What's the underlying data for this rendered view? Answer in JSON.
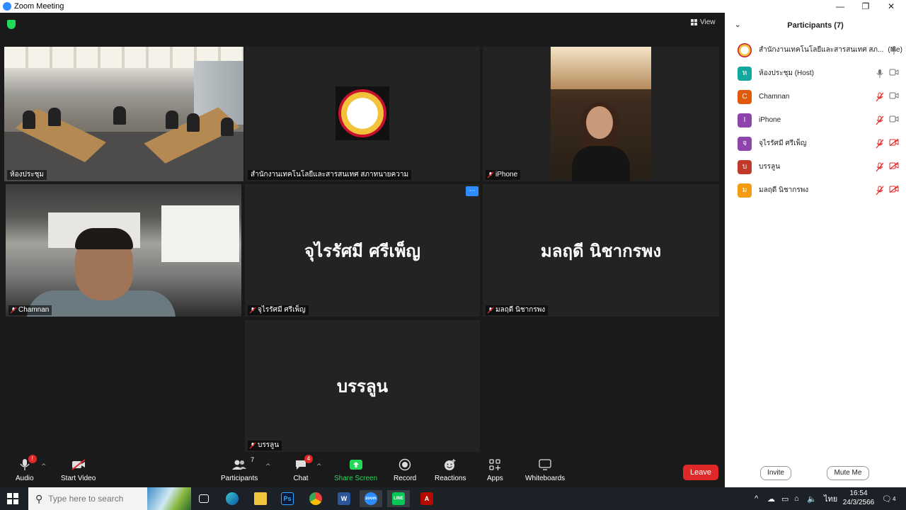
{
  "window": {
    "title": "Zoom Meeting",
    "controls": [
      "—",
      "❐",
      "✕"
    ]
  },
  "meeting": {
    "view_label": "View",
    "tiles": [
      {
        "name": "ห้องประชุม",
        "type": "video-room",
        "active": true
      },
      {
        "name": "สำนักงานเทคโนโลยีและสารสนเทศ สภาทนายความ",
        "type": "logo"
      },
      {
        "name": "iPhone",
        "type": "video-woman"
      },
      {
        "name": "Chamnan",
        "type": "video-car"
      },
      {
        "name": "จุไรรัศมี  ศรีเพ็ญ",
        "type": "name"
      },
      {
        "name": "มลฤดี  นิชากรพง",
        "type": "name"
      },
      {
        "name": "บรรลูน",
        "type": "name"
      }
    ],
    "more_options": "···"
  },
  "toolbar": {
    "audio_label": "Audio",
    "audio_badge": "!",
    "start_video_label": "Start Video",
    "participants_label": "Participants",
    "participants_count": "7",
    "chat_label": "Chat",
    "chat_badge": "4",
    "share_label": "Share Screen",
    "record_label": "Record",
    "reactions_label": "Reactions",
    "apps_label": "Apps",
    "whiteboards_label": "Whiteboards",
    "leave_label": "Leave"
  },
  "panel": {
    "title": "Participants (7)",
    "participants": [
      {
        "initial": "",
        "name": "สำนักงานเทคโนโลยีและสารสนเทศ สภ...",
        "suffix": "(Me)",
        "color": "#f3f3f3",
        "mic": "mic",
        "video": ""
      },
      {
        "initial": "ห",
        "name": "ห้องประชุม (Host)",
        "suffix": "",
        "color": "#13a89e",
        "mic": "mic",
        "video": "cam"
      },
      {
        "initial": "C",
        "name": "Chamnan",
        "suffix": "",
        "color": "#e05a0c",
        "mic": "mic-muted",
        "video": "cam"
      },
      {
        "initial": "I",
        "name": "iPhone",
        "suffix": "",
        "color": "#8e44ad",
        "mic": "mic-muted",
        "video": "cam"
      },
      {
        "initial": "จ",
        "name": "จุไรรัศมี  ศรีเพ็ญ",
        "suffix": "",
        "color": "#8e44ad",
        "mic": "mic-muted",
        "video": "cam-off"
      },
      {
        "initial": "บ",
        "name": "บรรลูน",
        "suffix": "",
        "color": "#c0392b",
        "mic": "mic-muted",
        "video": "cam-off"
      },
      {
        "initial": "ม",
        "name": "มลฤดี   นิชากรพง",
        "suffix": "",
        "color": "#f39c12",
        "mic": "mic-muted",
        "video": "cam-off"
      }
    ],
    "invite_label": "Invite",
    "mute_me_label": "Mute Me"
  },
  "taskbar": {
    "search_placeholder": "Type here to search",
    "language": "ไทย",
    "time": "16:54",
    "date": "24/3/2566",
    "notification_count": "4",
    "apps": [
      "task-view",
      "edge",
      "file-explorer",
      "photoshop",
      "chrome",
      "word",
      "zoom",
      "line",
      "acrobat"
    ]
  }
}
